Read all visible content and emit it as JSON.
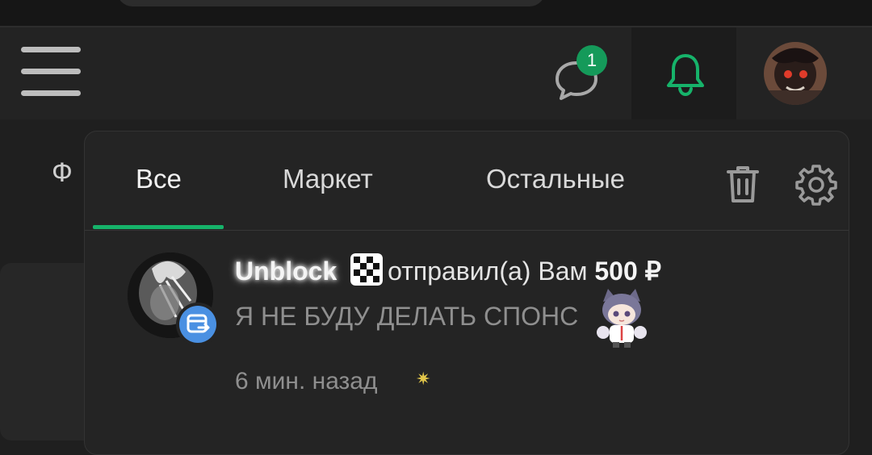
{
  "header": {
    "chat_badge_count": "1"
  },
  "page": {
    "partial_text": "Ф"
  },
  "notifications_panel": {
    "tabs": [
      {
        "label": "Все",
        "active": true
      },
      {
        "label": "Маркет",
        "active": false
      },
      {
        "label": "Остальные",
        "active": false
      }
    ],
    "items": [
      {
        "username": "Unblock",
        "action_text": "отправил(а) Вам",
        "amount": "500 ₽",
        "message": "Я НЕ БУДУ ДЕЛАТЬ СПОНС",
        "time": "6 мин. назад"
      }
    ]
  },
  "colors": {
    "accent": "#16b36a",
    "badge": "#159a5a",
    "transfer_icon": "#4a90e2"
  }
}
